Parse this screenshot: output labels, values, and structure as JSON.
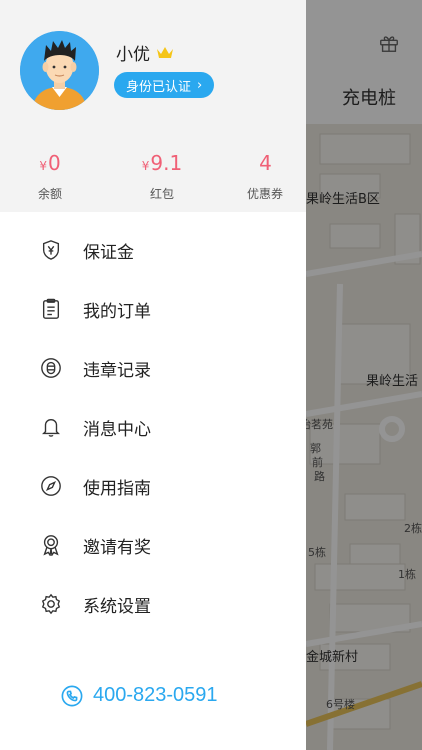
{
  "background": {
    "tab_label": "充电桩",
    "map_labels": [
      "果岭生活B区",
      "果岭生活",
      "怡茗苑",
      "郭",
      "前",
      "路",
      "2栋",
      "5栋",
      "1栋",
      "金城新村",
      "6号楼"
    ]
  },
  "profile": {
    "username": "小优",
    "verify_label": "身份已认证",
    "verify_chevron": "›"
  },
  "stats": [
    {
      "currency": "¥",
      "value": "0",
      "label": "余额"
    },
    {
      "currency": "¥",
      "value": "9.1",
      "label": "红包"
    },
    {
      "currency": "",
      "value": "4",
      "label": "优惠券"
    }
  ],
  "menu": [
    {
      "label": "保证金",
      "icon": "shield-yen-icon"
    },
    {
      "label": "我的订单",
      "icon": "clipboard-icon"
    },
    {
      "label": "违章记录",
      "icon": "ticket-icon"
    },
    {
      "label": "消息中心",
      "icon": "bell-icon"
    },
    {
      "label": "使用指南",
      "icon": "compass-icon"
    },
    {
      "label": "邀请有奖",
      "icon": "award-icon"
    },
    {
      "label": "系统设置",
      "icon": "gear-icon"
    }
  ],
  "phone": {
    "number": "400-823-0591",
    "icon": "phone-icon"
  },
  "colors": {
    "accent": "#2aa8ef",
    "stat_value": "#f06076",
    "crown": "#f5c518"
  }
}
